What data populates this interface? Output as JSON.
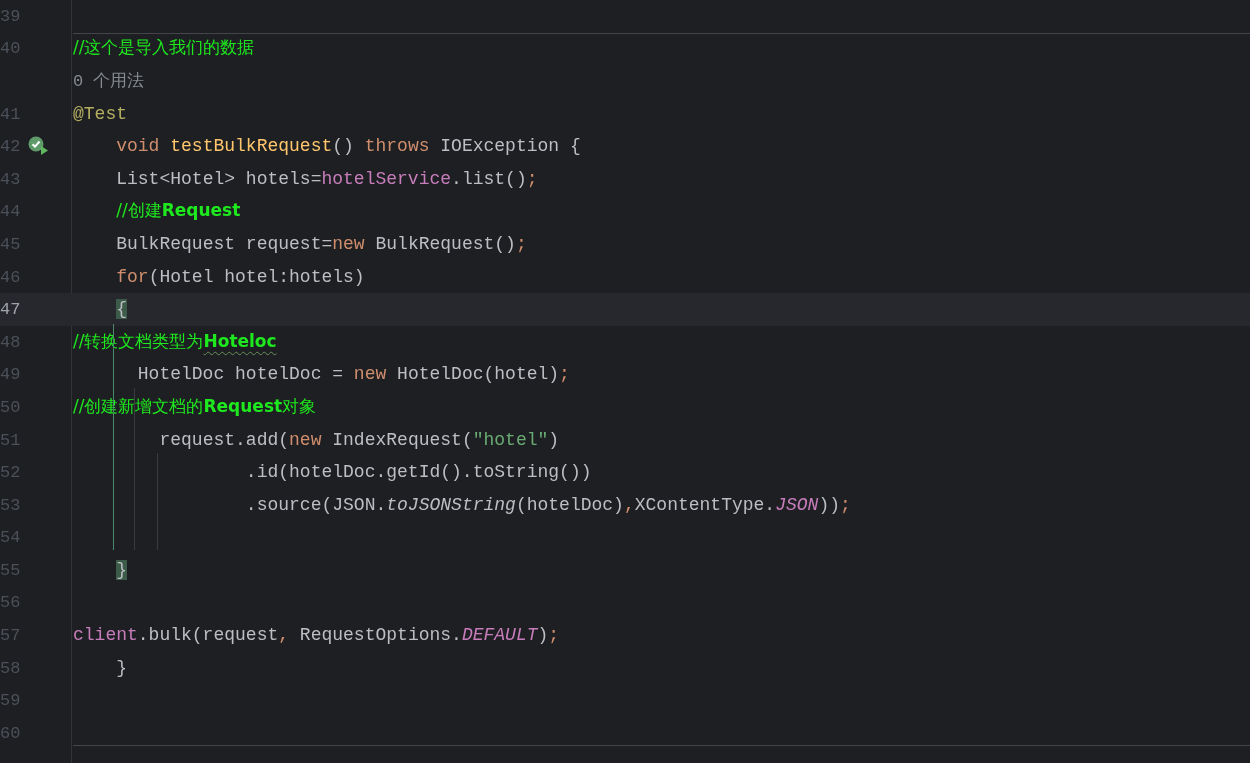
{
  "editor": {
    "bottom_divider": true,
    "rows": [
      {
        "kind": "code",
        "number": "39",
        "current": false,
        "divider_above": false,
        "tokens": []
      },
      {
        "kind": "code",
        "number": "40",
        "current": false,
        "divider_above": true,
        "tokens": [
          {
            "text": "//这个是导入我们的数据",
            "kind": "comment"
          }
        ]
      },
      {
        "kind": "hint",
        "text": "0 个用法",
        "divider_above": false
      },
      {
        "kind": "code",
        "number": "41",
        "current": false,
        "divider_above": false,
        "tokens": [
          {
            "text": "@Test",
            "kind": "annotation"
          }
        ]
      },
      {
        "kind": "code",
        "number": "42",
        "current": false,
        "divider_above": false,
        "test_passed": true,
        "tokens": [
          {
            "text": "    void ",
            "kind": "keyword"
          },
          {
            "text": "testBulkRequest",
            "kind": "function"
          },
          {
            "text": "() ",
            "kind": "plain"
          },
          {
            "text": "throws ",
            "kind": "keyword"
          },
          {
            "text": "IOException {",
            "kind": "plain"
          }
        ]
      },
      {
        "kind": "code",
        "number": "43",
        "current": false,
        "divider_above": false,
        "tokens": [
          {
            "text": "    List<Hotel> hotels=",
            "kind": "plain"
          },
          {
            "text": "hotelService",
            "kind": "field"
          },
          {
            "text": ".list()",
            "kind": "plain"
          },
          {
            "text": ";",
            "kind": "keyword"
          }
        ]
      },
      {
        "kind": "code",
        "number": "44",
        "current": false,
        "divider_above": false,
        "tokens": [
          {
            "text": "    //创建",
            "kind": "comment"
          },
          {
            "text": "Request",
            "kind": "comment_bold"
          }
        ]
      },
      {
        "kind": "code",
        "number": "45",
        "current": false,
        "divider_above": false,
        "tokens": [
          {
            "text": "    BulkRequest request=",
            "kind": "plain"
          },
          {
            "text": "new ",
            "kind": "keyword"
          },
          {
            "text": "BulkRequest()",
            "kind": "plain"
          },
          {
            "text": ";",
            "kind": "keyword"
          }
        ]
      },
      {
        "kind": "code",
        "number": "46",
        "current": false,
        "divider_above": false,
        "tokens": [
          {
            "text": "    for",
            "kind": "keyword"
          },
          {
            "text": "(Hotel hotel:hotels)",
            "kind": "plain"
          }
        ]
      },
      {
        "kind": "code",
        "number": "47",
        "current": true,
        "divider_above": false,
        "tokens": [
          {
            "text": "    {",
            "kind": "brace_match"
          }
        ]
      },
      {
        "kind": "code",
        "number": "48",
        "current": false,
        "divider_above": false,
        "tokens": [
          {
            "text": "//转换文档类型为",
            "kind": "comment"
          },
          {
            "text": "Hoteloc",
            "kind": "comment_typo"
          }
        ]
      },
      {
        "kind": "code",
        "number": "49",
        "current": false,
        "divider_above": false,
        "tokens": [
          {
            "text": "      HotelDoc hotelDoc = ",
            "kind": "plain"
          },
          {
            "text": "new ",
            "kind": "keyword"
          },
          {
            "text": "HotelDoc(hotel)",
            "kind": "plain"
          },
          {
            "text": ";",
            "kind": "keyword"
          }
        ]
      },
      {
        "kind": "code",
        "number": "50",
        "current": false,
        "divider_above": false,
        "tokens": [
          {
            "text": "//创建新增文档的",
            "kind": "comment"
          },
          {
            "text": "Request",
            "kind": "comment_bold"
          },
          {
            "text": "对象",
            "kind": "comment"
          }
        ]
      },
      {
        "kind": "code",
        "number": "51",
        "current": false,
        "divider_above": false,
        "tokens": [
          {
            "text": "        request.add(",
            "kind": "plain"
          },
          {
            "text": "new ",
            "kind": "keyword"
          },
          {
            "text": "IndexRequest(",
            "kind": "plain"
          },
          {
            "text": "\"hotel\"",
            "kind": "string"
          },
          {
            "text": ")",
            "kind": "plain"
          }
        ]
      },
      {
        "kind": "code",
        "number": "52",
        "current": false,
        "divider_above": false,
        "tokens": [
          {
            "text": "                .id(hotelDoc.getId().toString())",
            "kind": "plain"
          }
        ]
      },
      {
        "kind": "code",
        "number": "53",
        "current": false,
        "divider_above": false,
        "tokens": [
          {
            "text": "                .source(JSON.",
            "kind": "plain"
          },
          {
            "text": "toJSONString",
            "kind": "static_method"
          },
          {
            "text": "(hotelDoc)",
            "kind": "plain"
          },
          {
            "text": ",",
            "kind": "keyword"
          },
          {
            "text": "XContentType.",
            "kind": "plain"
          },
          {
            "text": "JSON",
            "kind": "static_field"
          },
          {
            "text": "))",
            "kind": "plain"
          },
          {
            "text": ";",
            "kind": "keyword"
          }
        ]
      },
      {
        "kind": "code",
        "number": "54",
        "current": false,
        "divider_above": false,
        "tokens": []
      },
      {
        "kind": "code",
        "number": "55",
        "current": false,
        "divider_above": false,
        "tokens": [
          {
            "text": "    }",
            "kind": "brace_match"
          }
        ]
      },
      {
        "kind": "code",
        "number": "56",
        "current": false,
        "divider_above": false,
        "tokens": []
      },
      {
        "kind": "code",
        "number": "57",
        "current": false,
        "divider_above": false,
        "tokens": [
          {
            "text": "client",
            "kind": "field"
          },
          {
            "text": ".bulk(request",
            "kind": "plain"
          },
          {
            "text": ", ",
            "kind": "keyword"
          },
          {
            "text": "RequestOptions.",
            "kind": "plain"
          },
          {
            "text": "DEFAULT",
            "kind": "static_field"
          },
          {
            "text": ")",
            "kind": "plain"
          },
          {
            "text": ";",
            "kind": "keyword"
          }
        ]
      },
      {
        "kind": "code",
        "number": "58",
        "current": false,
        "divider_above": false,
        "tokens": [
          {
            "text": "    }",
            "kind": "plain"
          }
        ]
      },
      {
        "kind": "code",
        "number": "59",
        "current": false,
        "divider_above": false,
        "tokens": []
      },
      {
        "kind": "code",
        "number": "60",
        "current": false,
        "divider_above": false,
        "tokens": []
      }
    ]
  }
}
